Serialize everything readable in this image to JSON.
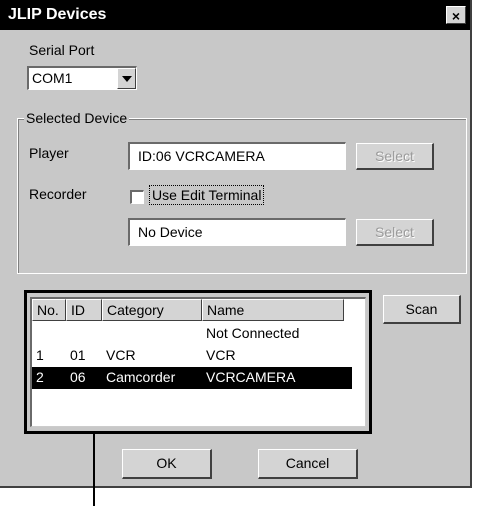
{
  "window": {
    "title": "JLIP Devices",
    "close_glyph": "×"
  },
  "serial_port": {
    "label": "Serial Port",
    "value": "COM1"
  },
  "selected_device": {
    "group_label": "Selected Device",
    "player_label": "Player",
    "player_value": "ID:06 VCRCAMERA",
    "player_select": "Select",
    "recorder_label": "Recorder",
    "use_edit_terminal": "Use Edit Terminal",
    "use_edit_terminal_checked": false,
    "recorder_value": "No Device",
    "recorder_select": "Select"
  },
  "device_list": {
    "columns": [
      "No.",
      "ID",
      "Category",
      "Name"
    ],
    "rows": [
      {
        "no": "",
        "id": "",
        "category": "",
        "name": "Not Connected",
        "selected": false
      },
      {
        "no": "1",
        "id": "01",
        "category": "VCR",
        "name": "VCR",
        "selected": false
      },
      {
        "no": "2",
        "id": "06",
        "category": "Camcorder",
        "name": "VCRCAMERA",
        "selected": true
      }
    ]
  },
  "buttons": {
    "scan": "Scan",
    "ok": "OK",
    "cancel": "Cancel"
  },
  "colors": {
    "dialog_bg": "#c8c8c8",
    "titlebar_bg": "#000000",
    "selection_bg": "#000000"
  }
}
